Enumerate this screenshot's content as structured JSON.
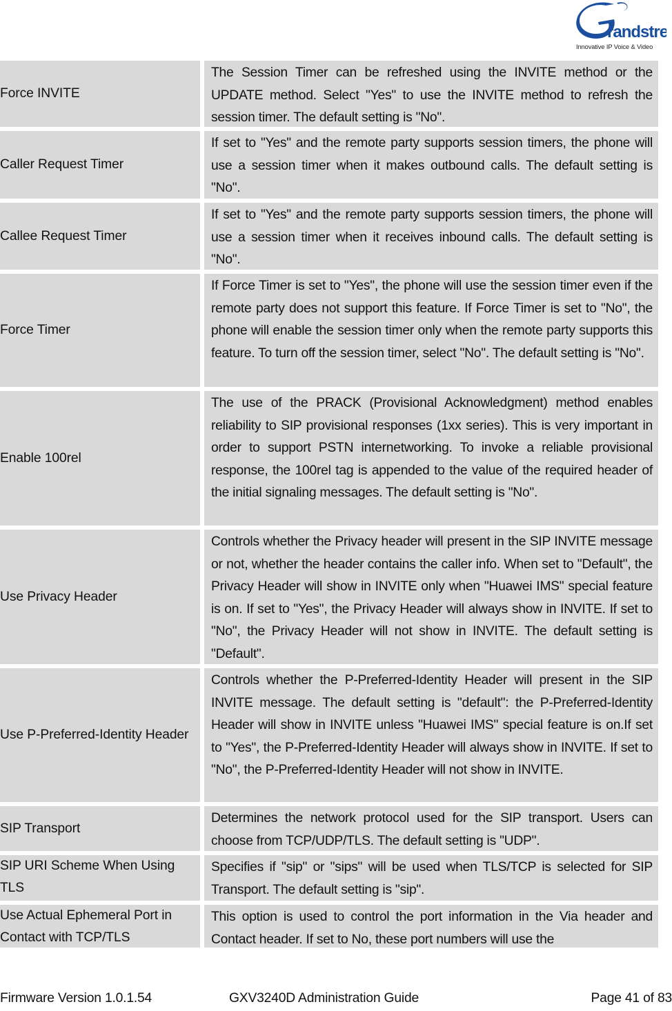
{
  "header": {
    "logo": {
      "brand": "Grandstream",
      "tagline": "Innovative IP Voice & Video",
      "color": "#1a4fa0"
    }
  },
  "table": {
    "rows": [
      {
        "name": "Force INVITE",
        "description": "The Session Timer can be refreshed using the INVITE method or the UPDATE method. Select \"Yes\" to use the INVITE method to refresh the session timer. The default setting is \"No\"."
      },
      {
        "name": "Caller Request Timer",
        "description": "If set to \"Yes\" and the remote party supports session timers, the phone will use a session timer when it makes outbound calls. The default setting is \"No\"."
      },
      {
        "name": "Callee Request Timer",
        "description": "If set to \"Yes\" and the remote party supports session timers, the phone will use a session timer when it receives inbound calls. The default setting is \"No\"."
      },
      {
        "name": "Force Timer",
        "description": "If Force Timer is set to \"Yes\", the phone will use the session timer even if the remote party does not support this feature. If Force Timer is set to \"No\", the phone will enable the session timer only when the remote party supports this feature. To turn off the session timer, select \"No\". The default setting is \"No\"."
      },
      {
        "name": "Enable 100rel",
        "description": "The use of the PRACK (Provisional Acknowledgment) method enables reliability to SIP provisional responses (1xx series). This is very important in order to support PSTN internetworking. To invoke a reliable provisional response, the 100rel tag is appended to the value of the required header of the initial signaling messages. The default setting is \"No\"."
      },
      {
        "name": "Use Privacy Header",
        "description": "Controls whether the Privacy header will present in the SIP INVITE message or not, whether the header contains the caller info. When set to \"Default\", the Privacy Header will show in INVITE only when \"Huawei IMS\" special feature is on. If set to \"Yes\", the Privacy Header will always show in INVITE. If set to \"No\", the Privacy Header will not show in INVITE. The default setting is \"Default\"."
      },
      {
        "name": "Use P-Preferred-Identity Header",
        "description": "Controls whether the P-Preferred-Identity Header will present in the SIP INVITE message. The default setting is \"default\": the P-Preferred-Identity Header will show in INVITE unless \"Huawei IMS\" special feature is on.If set to \"Yes\", the P-Preferred-Identity Header will always show in INVITE. If set to \"No\", the P-Preferred-Identity Header will not show in INVITE."
      },
      {
        "name": "SIP Transport",
        "description": "Determines the network protocol used for the SIP transport. Users can choose from TCP/UDP/TLS. The default setting is \"UDP\"."
      },
      {
        "name": "SIP URI Scheme When Using TLS",
        "description": "Specifies if \"sip\" or \"sips\" will be used when TLS/TCP is selected for SIP Transport. The default setting is \"sip\"."
      },
      {
        "name": "Use Actual Ephemeral Port in Contact with TCP/TLS",
        "description": "This option is used to control the port information in the Via header and Contact header. If set to No, these port numbers will use the"
      }
    ]
  },
  "footer": {
    "firmware": "Firmware Version 1.0.1.54",
    "title": "GXV3240D Administration Guide",
    "page": "Page 41 of 83"
  }
}
